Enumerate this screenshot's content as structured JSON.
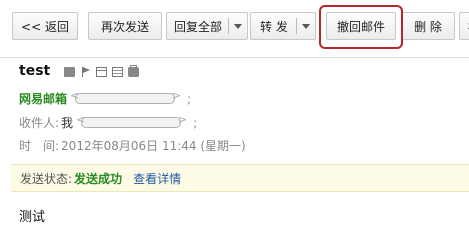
{
  "toolbar": {
    "back": "<< 返回",
    "resend": "再次发送",
    "reply_all": "回复全部",
    "forward": "转 发",
    "recall": "撤回邮件",
    "delete": "删 除",
    "more": "标"
  },
  "mail": {
    "subject": "test",
    "sender_name": "网易邮箱",
    "recipient_label": "收件人:",
    "recipient_name": "我",
    "time_label": "时　间:",
    "time_value": "2012年08月06日 11:44 (星期一)",
    "separator": ";"
  },
  "status": {
    "label": "发送状态:",
    "value": "发送成功",
    "detail_link": "查看详情"
  },
  "body": {
    "text": "测试"
  },
  "colors": {
    "sender_green": "#2b8a24",
    "link_blue": "#1f5aa6",
    "highlight_red": "#b8262c",
    "status_bg": "#fdfbe6"
  }
}
